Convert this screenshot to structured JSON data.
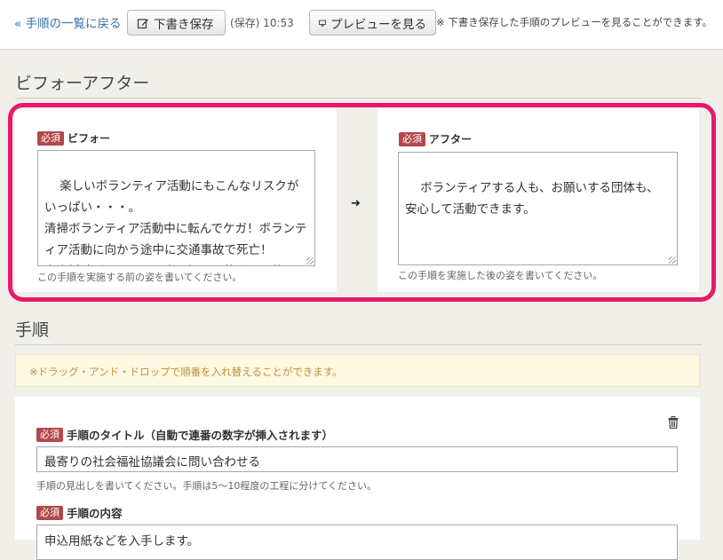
{
  "toolbar": {
    "back_link": "« 手順の一覧に戻る",
    "draft_button": "下書き保存",
    "saved_status": "(保存) 10:53",
    "preview_button": "プレビューを見る",
    "preview_note": "※ 下書き保存した手順のプレビューを見ることができます。"
  },
  "before_after": {
    "section_title": "ビフォーアフター",
    "required_badge": "必須",
    "before": {
      "label": "ビフォー",
      "value": "楽しいボランティア活動にもこんなリスクがいっぱい・・・。\n清掃ボランティア活動中に転んでケガ！ボランティア活動に向かう途中に交通事故で死亡！\n家事援助ボランティア中、誤って花びんを落として破損！",
      "help": "この手順を実施する前の姿を書いてください。"
    },
    "after": {
      "label": "アフター",
      "value": "ボランティアする人も、お願いする団体も、安心して活動できます。",
      "help": "この手順を実施した後の姿を書いてください。"
    },
    "arrow_icon": "arrow-right-icon",
    "highlight_color": "#e8186a"
  },
  "procedure": {
    "section_title": "手順",
    "notice": "※ドラッグ・アンド・ドロップで順番を入れ替えることができます。",
    "required_badge": "必須",
    "step": {
      "title_label": "手順のタイトル（自動で連番の数字が挿入されます）",
      "title_value": "最寄りの社会福祉協議会に問い合わせる",
      "title_help": "手順の見出しを書いてください。手順は5〜10程度の工程に分けてください。",
      "content_label": "手順の内容",
      "content_value": "申込用紙などを入手します。"
    }
  },
  "colors": {
    "badge": "#b3474a",
    "link": "#3a6fae",
    "notice_text": "#c0913a"
  }
}
